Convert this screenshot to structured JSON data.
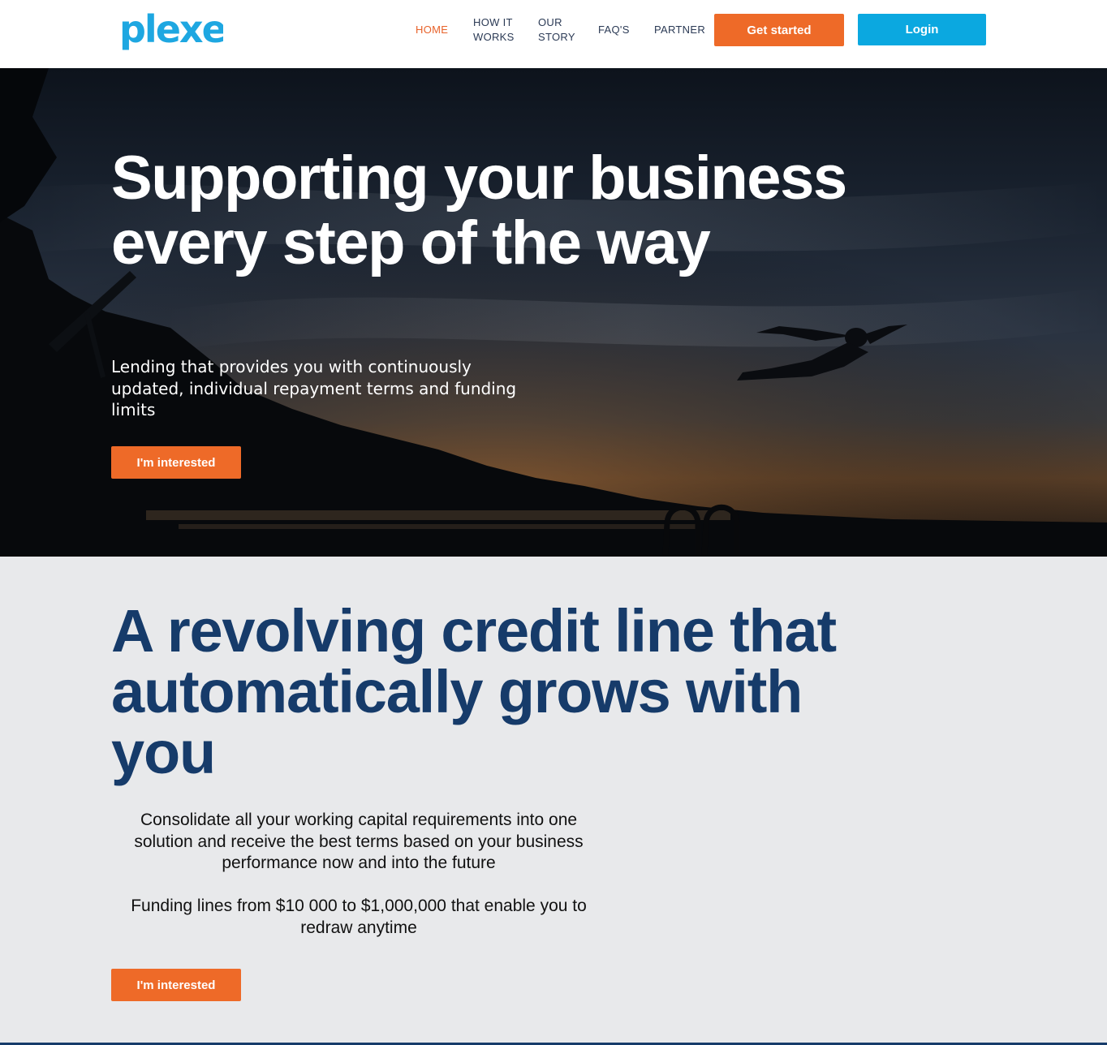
{
  "header": {
    "logo_text": "plexe",
    "nav": [
      {
        "label": "HOME",
        "active": true
      },
      {
        "label": "HOW IT\nWORKS",
        "active": false
      },
      {
        "label": "OUR\nSTORY",
        "active": false
      },
      {
        "label": "FAQ'S",
        "active": false
      },
      {
        "label": "PARTNER",
        "active": false
      }
    ],
    "get_started_label": "Get started",
    "login_label": "Login"
  },
  "hero": {
    "title": "Supporting your business every step of the way",
    "subtitle": "Lending that provides you with continuously updated, individual repayment terms and funding limits",
    "cta_label": "I'm interested"
  },
  "section2": {
    "title": "A revolving credit line that automatically grows with you",
    "paragraph1": "Consolidate all your working capital requirements into one solution and receive the best terms based on your business performance now and into the future",
    "paragraph2": "Funding lines from $10 000 to $1,000,000 that enable you to redraw anytime",
    "cta_label": "I'm interested"
  },
  "colors": {
    "brand_blue": "#1ea7e1",
    "accent_orange": "#ee6a28",
    "login_blue": "#0ba8e0",
    "heading_navy": "#163b6a",
    "nav_active": "#e8622a"
  }
}
